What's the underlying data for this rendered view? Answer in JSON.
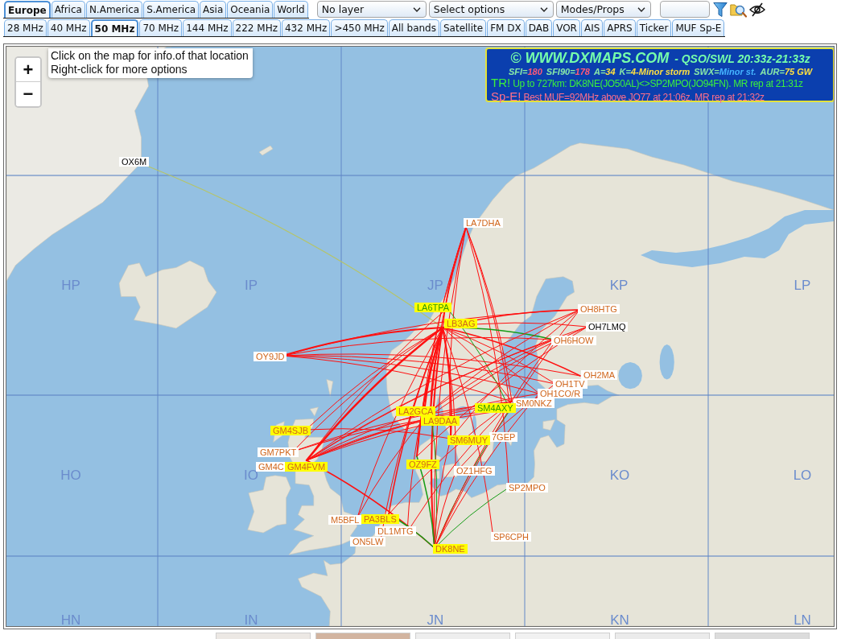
{
  "region_tabs": [
    {
      "label": "Europe",
      "selected": true
    },
    {
      "label": "Africa",
      "selected": false
    },
    {
      "label": "N.America",
      "selected": false
    },
    {
      "label": "S.America",
      "selected": false
    },
    {
      "label": "Asia",
      "selected": false
    },
    {
      "label": "Oceania",
      "selected": false
    },
    {
      "label": "World",
      "selected": false
    }
  ],
  "dropdowns": [
    {
      "value": "No layer"
    },
    {
      "value": "Select options"
    },
    {
      "value": "Modes/Props"
    }
  ],
  "band_tabs": [
    {
      "label": "28 MHz",
      "selected": false
    },
    {
      "label": "40 MHz",
      "selected": false
    },
    {
      "label": "50 MHz",
      "selected": true
    },
    {
      "label": "70 MHz",
      "selected": false
    },
    {
      "label": "144 MHz",
      "selected": false
    },
    {
      "label": "222 MHz",
      "selected": false
    },
    {
      "label": "432 MHz",
      "selected": false
    },
    {
      "label": ">450 MHz",
      "selected": false
    },
    {
      "label": "All bands",
      "selected": false
    },
    {
      "label": "Satellite",
      "selected": false
    },
    {
      "label": "FM DX",
      "selected": false
    },
    {
      "label": "DAB",
      "selected": false
    },
    {
      "label": "VOR",
      "selected": false
    },
    {
      "label": "AIS",
      "selected": false
    },
    {
      "label": "APRS",
      "selected": false
    },
    {
      "label": "Ticker",
      "selected": false
    },
    {
      "label": "MUF Sp-E",
      "selected": false
    }
  ],
  "map": {
    "zoom_controls": [
      "+",
      "−"
    ],
    "hint_lines": [
      "Click on the map for info.of that location",
      "Right-click for more options"
    ],
    "banner": {
      "title": "© WWW.DXMAPS.COM",
      "period": "- QSO/SWL 20:33z-21:33z",
      "solar_indices": [
        {
          "label": "SFI=",
          "value": "180",
          "color": "#ff5a78"
        },
        {
          "label": "SFI90=",
          "value": "178",
          "color": "#ff5a78"
        },
        {
          "label": "A=",
          "value": "34",
          "color": "#ffe040"
        },
        {
          "label": "K=",
          "value": "4-Minor storm",
          "color": "#ffe040"
        },
        {
          "label": "SWX=",
          "value": "Minor st.",
          "color": "#45b4ff"
        },
        {
          "label": "AUR=",
          "value": "75 GW",
          "color": "#ffe040"
        }
      ],
      "alerts": [
        {
          "tag": "TR!",
          "text": "Up to 727km: DK8NE(JO50AL)<>SP2MPO(JO94FN). MR rep at 21:31z",
          "color": "#3cf03c"
        },
        {
          "tag": "Sp-E!",
          "text": "Best MUF=92MHz above JO77 at 21:06z. MR rep at 21:32z",
          "color": "#ff6f8a"
        }
      ]
    },
    "grid_labels": [
      "HP",
      "IP",
      "JP",
      "KP",
      "LP",
      "HO",
      "IO",
      "KO",
      "LO",
      "HN",
      "IN",
      "JN",
      "KN",
      "LN"
    ],
    "stations": [
      {
        "call": "OX6M",
        "highlighted": false,
        "color": "#000000"
      },
      {
        "call": "LA7DHA",
        "highlighted": false,
        "color": "#d0661c"
      },
      {
        "call": "LA6TPA",
        "highlighted": true,
        "color": "#2f9a00"
      },
      {
        "call": "OH8HTG",
        "highlighted": false,
        "color": "#d0661c"
      },
      {
        "call": "LB3AG",
        "highlighted": true,
        "color": "#d0661c"
      },
      {
        "call": "OH7LMQ",
        "highlighted": false,
        "color": "#000000"
      },
      {
        "call": "OH6HOW",
        "highlighted": false,
        "color": "#d0661c"
      },
      {
        "call": "OY9JD",
        "highlighted": false,
        "color": "#d0661c"
      },
      {
        "call": "OH2MA",
        "highlighted": false,
        "color": "#d0661c"
      },
      {
        "call": "OH1TV",
        "highlighted": false,
        "color": "#d0661c"
      },
      {
        "call": "OH1CO/R",
        "highlighted": false,
        "color": "#d0661c"
      },
      {
        "call": "SM0NKZ",
        "highlighted": false,
        "color": "#d0661c"
      },
      {
        "call": "SM4AXY",
        "highlighted": true,
        "color": "#2f9a00"
      },
      {
        "call": "LA2GCA",
        "highlighted": true,
        "color": "#d0661c"
      },
      {
        "call": "LA9DAA",
        "highlighted": true,
        "color": "#d0661c"
      },
      {
        "call": "GM4SJB",
        "highlighted": true,
        "color": "#d0661c"
      },
      {
        "call": "7GEP",
        "highlighted": false,
        "color": "#d0661c"
      },
      {
        "call": "SM6MUY",
        "highlighted": true,
        "color": "#d0661c"
      },
      {
        "call": "GM7PKT",
        "highlighted": false,
        "color": "#d0661c"
      },
      {
        "call": "GM4C",
        "highlighted": false,
        "color": "#d0661c"
      },
      {
        "call": "GM4FVM",
        "highlighted": true,
        "color": "#d0661c"
      },
      {
        "call": "OZ9FZ",
        "highlighted": true,
        "color": "#d0661c"
      },
      {
        "call": "OZ1HFG",
        "highlighted": false,
        "color": "#d0661c"
      },
      {
        "call": "SP2MPO",
        "highlighted": false,
        "color": "#d0661c"
      },
      {
        "call": "M5BFL",
        "highlighted": false,
        "color": "#d0661c"
      },
      {
        "call": "PA3BLS",
        "highlighted": true,
        "color": "#d0661c"
      },
      {
        "call": "DL1MTG",
        "highlighted": false,
        "color": "#d0661c"
      },
      {
        "call": "ON5LW",
        "highlighted": false,
        "color": "#d0661c"
      },
      {
        "call": "SP6CPH",
        "highlighted": false,
        "color": "#d0661c"
      },
      {
        "call": "DK8NE",
        "highlighted": true,
        "color": "#d0661c"
      }
    ]
  }
}
